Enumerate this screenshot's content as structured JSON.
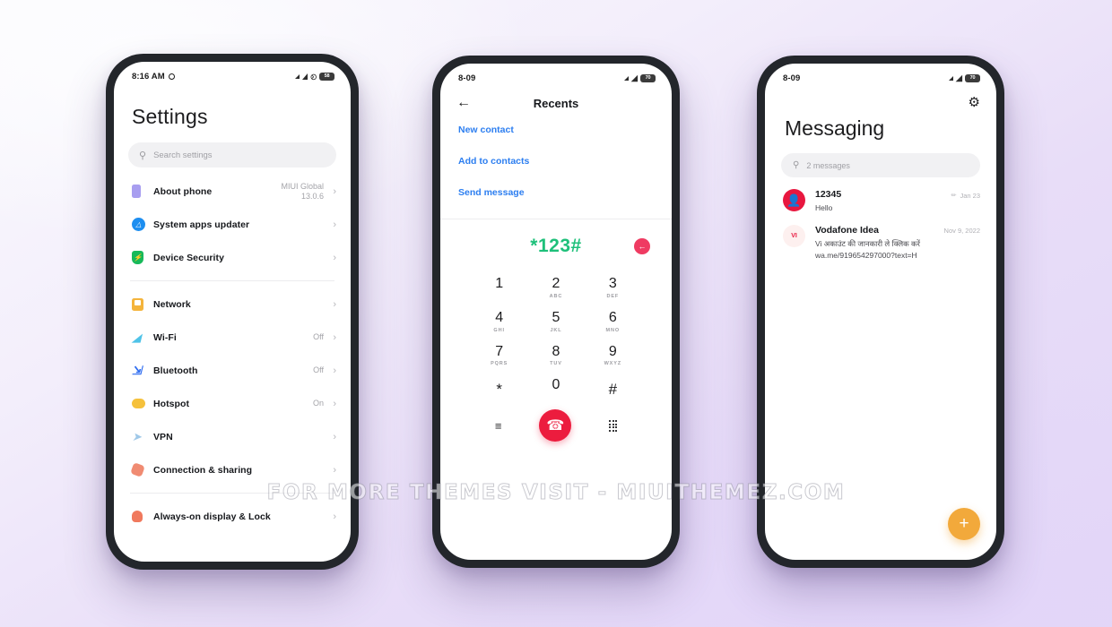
{
  "watermark": "FOR MORE THEMES VISIT - MIUITHEMEZ.COM",
  "colors": {
    "background_lavender": "#e2d6f7",
    "background_white": "#fafafd",
    "phone_frame": "#23262b",
    "accent_blue": "#2c7ef0",
    "accent_green": "#1ec07a",
    "accent_red": "#ec1c3e",
    "accent_orange": "#f2a93b",
    "avatar_red": "#e8173f"
  },
  "settings_phone": {
    "statusbar": {
      "time": "8:16 AM",
      "alarm_icon": "alarm-icon",
      "signal_icon": "signal-bars-icon",
      "vibrate_icon": "vibrate-icon",
      "battery_level": "58"
    },
    "title": "Settings",
    "search": {
      "icon": "search-icon",
      "placeholder": "Search settings",
      "value": ""
    },
    "groups": [
      {
        "items": [
          {
            "icon": "about-phone-icon",
            "label": "About phone",
            "value": "MIUI Global\n13.0.6",
            "chevron": "›"
          },
          {
            "icon": "system-updater-icon",
            "label": "System apps updater",
            "value": "",
            "chevron": "›"
          },
          {
            "icon": "device-security-icon",
            "label": "Device Security",
            "value": "",
            "chevron": "›"
          }
        ]
      },
      {
        "items": [
          {
            "icon": "network-sim-icon",
            "label": "Network",
            "value": "",
            "chevron": "›"
          },
          {
            "icon": "wifi-icon",
            "label": "Wi-Fi",
            "value": "Off",
            "chevron": "›"
          },
          {
            "icon": "bluetooth-icon",
            "label": "Bluetooth",
            "value": "Off",
            "chevron": "›"
          },
          {
            "icon": "hotspot-icon",
            "label": "Hotspot",
            "value": "On",
            "chevron": "›"
          },
          {
            "icon": "vpn-icon",
            "label": "VPN",
            "value": "",
            "chevron": "›"
          },
          {
            "icon": "connection-sharing-icon",
            "label": "Connection & sharing",
            "value": "",
            "chevron": "›"
          }
        ]
      },
      {
        "items": [
          {
            "icon": "always-on-display-icon",
            "label": "Always-on display & Lock",
            "value": "",
            "chevron": "›"
          }
        ]
      }
    ]
  },
  "dialer_phone": {
    "statusbar": {
      "time": "8-09",
      "signal_icon": "signal-bars-icon",
      "wifi_icon": "wifi-icon",
      "battery_level": "70"
    },
    "back_icon": "back-arrow-icon",
    "title": "Recents",
    "actions": [
      {
        "label": "New contact"
      },
      {
        "label": "Add to contacts"
      },
      {
        "label": "Send message"
      }
    ],
    "number_display": "*123#",
    "delete_icon": "backspace-icon",
    "keypad": [
      [
        {
          "digit": "1",
          "sub": ""
        },
        {
          "digit": "2",
          "sub": "ABC"
        },
        {
          "digit": "3",
          "sub": "DEF"
        }
      ],
      [
        {
          "digit": "4",
          "sub": "GHI"
        },
        {
          "digit": "5",
          "sub": "JKL"
        },
        {
          "digit": "6",
          "sub": "MNO"
        }
      ],
      [
        {
          "digit": "7",
          "sub": "PQRS"
        },
        {
          "digit": "8",
          "sub": "TUV"
        },
        {
          "digit": "9",
          "sub": "WXYZ"
        }
      ],
      [
        {
          "digit": "*",
          "sub": ""
        },
        {
          "digit": "0",
          "sub": "+"
        },
        {
          "digit": "#",
          "sub": ""
        }
      ]
    ],
    "bottom": {
      "menu_icon": "menu-lines-icon",
      "call_icon": "call-handset-icon",
      "keypad_icon": "keypad-grid-icon"
    }
  },
  "messaging_phone": {
    "statusbar": {
      "time": "8-09",
      "signal_icon": "signal-bars-icon",
      "wifi_icon": "wifi-icon",
      "battery_level": "70"
    },
    "settings_icon": "gear-icon",
    "title": "Messaging",
    "search": {
      "icon": "search-icon",
      "placeholder": "2 messages",
      "value": ""
    },
    "threads": [
      {
        "avatar_icon": "person-avatar-icon",
        "avatar_text": "",
        "name": "12345",
        "preview": "Hello",
        "pen_icon": "pencil-icon",
        "date": "Jan 23"
      },
      {
        "avatar_icon": "vi-logo-icon",
        "avatar_text": "VI",
        "name": "Vodafone Idea",
        "preview": "Vi अकाउंट की जानकारी ले क्लिक करें wa.me/919654297000?text=H",
        "pen_icon": "",
        "date": "Nov 9, 2022"
      }
    ],
    "fab": {
      "icon": "plus-icon",
      "label": "+"
    }
  }
}
